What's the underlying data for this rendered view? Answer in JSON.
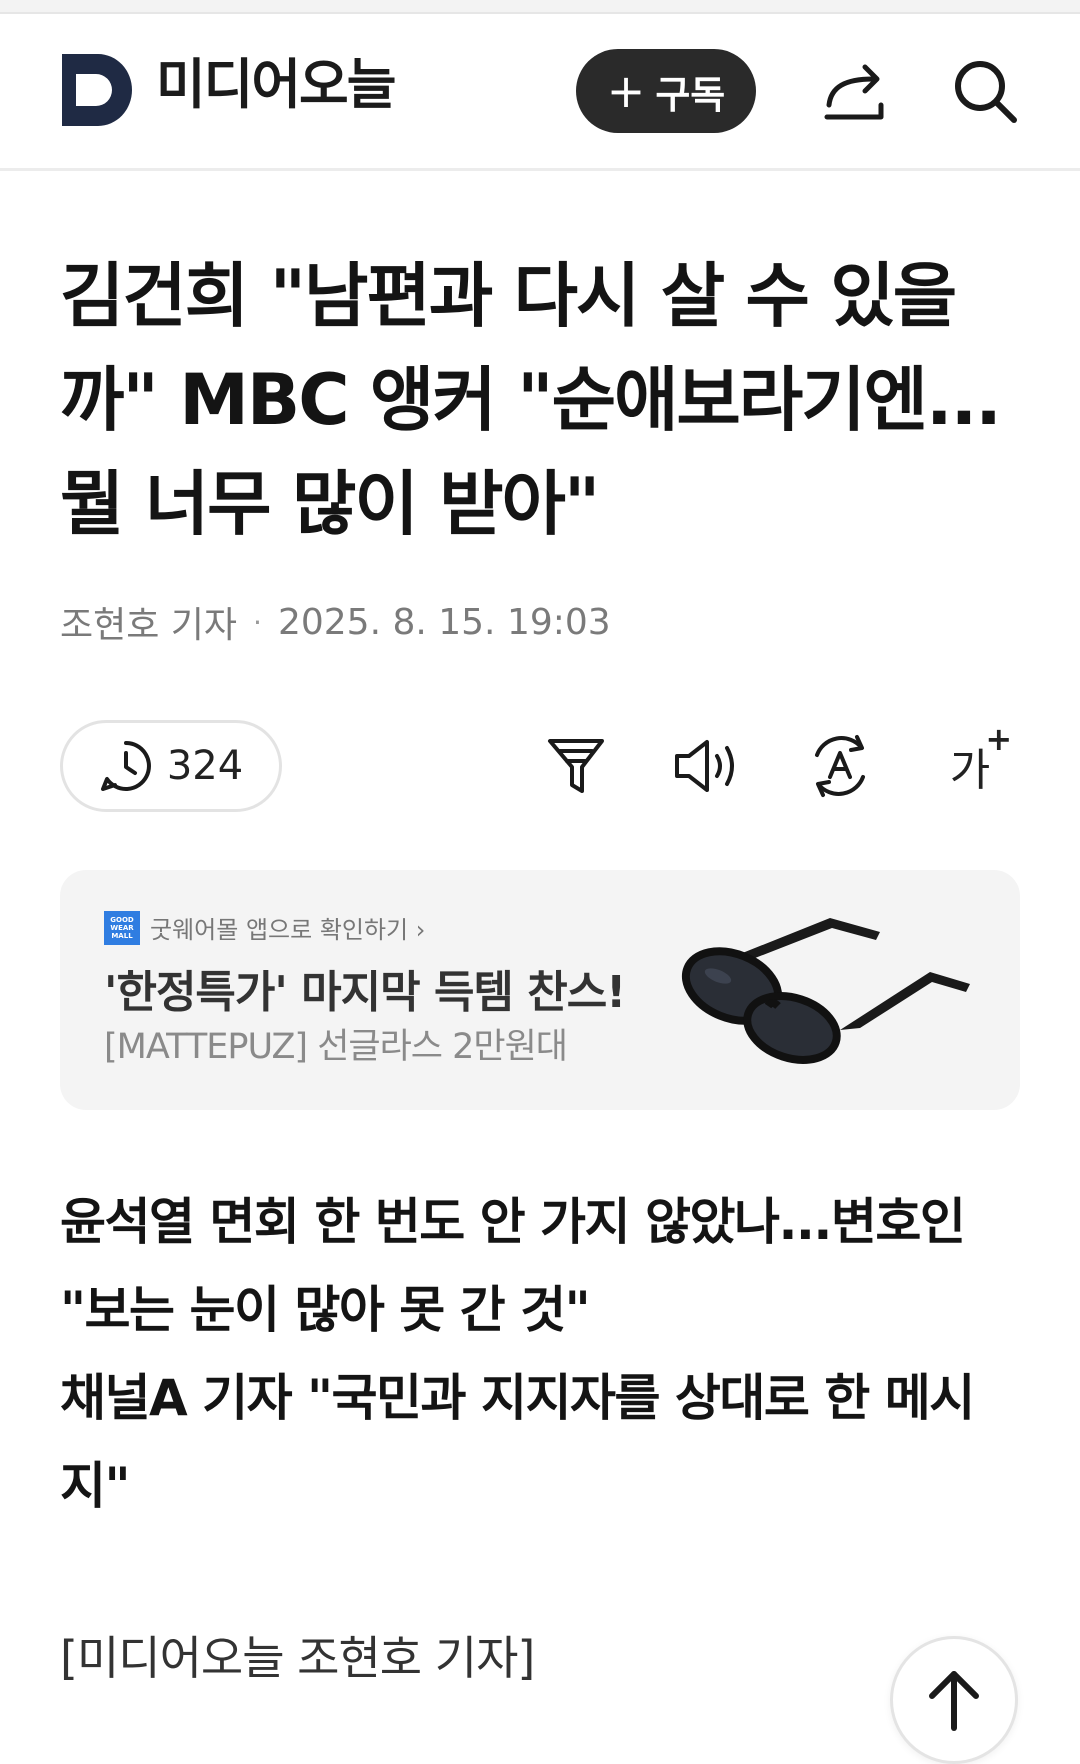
{
  "header": {
    "logo_text": "미디어오늘",
    "subscribe_label": "구독"
  },
  "icons": {
    "logo": "media-today-d-logo",
    "subscribe": "plus-icon",
    "share": "share-icon",
    "search": "search-icon",
    "comments": "clock-comment-icon",
    "filter": "funnel-icon",
    "audio": "speaker-icon",
    "translate": "translate-a-icon",
    "font": "font-size-icon",
    "scroll_top": "arrow-up-icon"
  },
  "article": {
    "headline": "김건희 \"남편과 다시 살 수 있을까\" MBC 앵커 \"순애보라기엔... 뭘 너무 많이 받아\"",
    "reporter": "조현호 기자",
    "datetime": "2025. 8. 15. 19:03",
    "comment_count": "324",
    "font_label": "가",
    "font_plus": "+",
    "sub_headline_1": "윤석열 면회 한 번도 안 가지 않았나...변호인 \"보는 눈이 많아 못 간 것\"",
    "sub_headline_2": "채널A 기자 \"국민과 지지자를 상대로 한 메시지\"",
    "reporter_tag": "[미디어오늘 조현호 기자]"
  },
  "ad": {
    "brand_logo_text": "GOOD WEAR MALL",
    "brand_link": "굿웨어몰 앱으로 확인하기 ›",
    "title": "'한정특가' 마지막 득템 찬스!",
    "subtitle": "[MATTEPUZ] 선글라스 2만원대"
  },
  "colors": {
    "brand_navy": "#1f2a44",
    "subscribe_bg": "#2a2a2a",
    "ad_bg": "#f4f4f4",
    "ad_logo_blue": "#2f7de1"
  }
}
